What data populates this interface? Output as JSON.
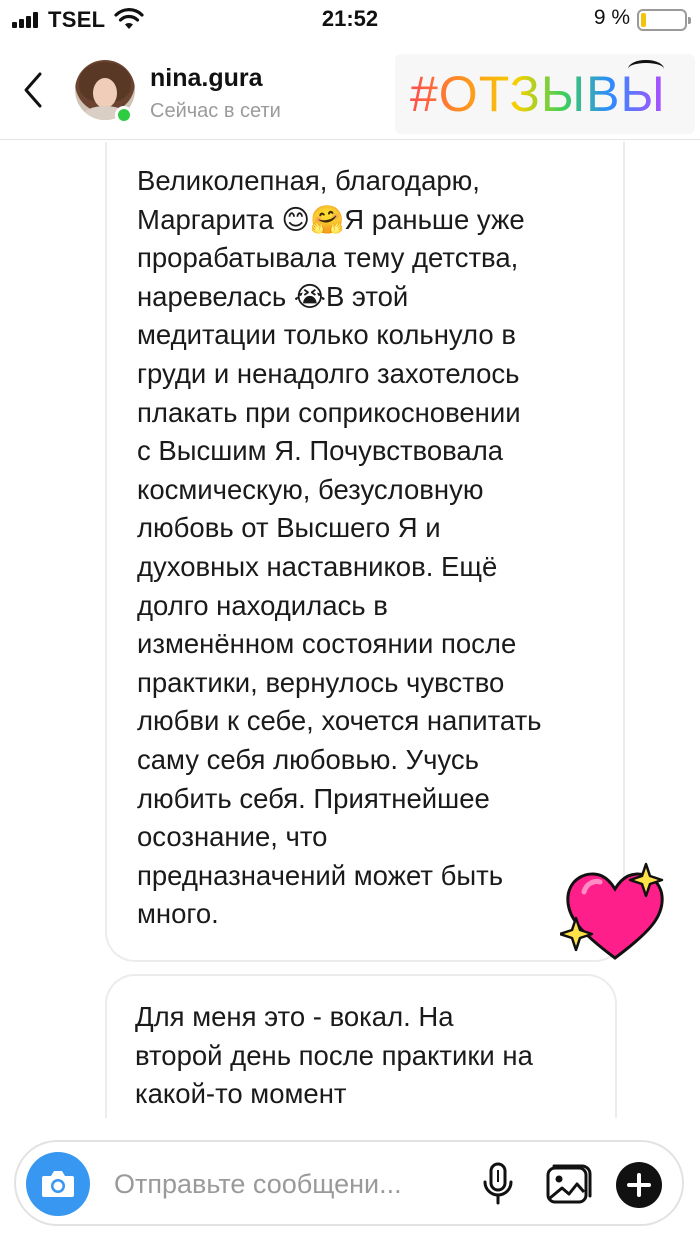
{
  "status_bar": {
    "carrier": "TSEL",
    "time": "21:52",
    "battery_percent": "9 %",
    "battery_level": 0.09
  },
  "header": {
    "username": "nina.gura",
    "presence": "Сейчас в сети",
    "sticker_text": "#ОТЗЫВЫ",
    "online": true
  },
  "messages": [
    {
      "text": "Великолепная, благодарю,\nМаргарита 😊🤗Я раньше уже\nпрорабатывала тему детства,\nнаревелась 😭В этой\nмедитации только кольнуло в\nгруди и ненадолго захотелось\nплакать при соприкосновении\nс Высшим Я. Почувствовала\nкосмическую, безусловную\nлюбовь от Высшего Я и\nдуховных наставников. Ещё\nдолго находилась в\nизменённом состоянии после\nпрактики, вернулось чувство\nлюбви к себе, хочется напитать\nсаму себя любовью. Учусь\nлюбить себя. Приятнейшее\nосознание, что\nпредназначений может быть\nмного."
    },
    {
      "text": "Для меня это - вокал. На\nвторой день после практики на\nкакой-то момент"
    }
  ],
  "composer": {
    "placeholder": "Отправьте сообщени...",
    "value": ""
  },
  "icons": {
    "back": "chevron-left-icon",
    "camera": "camera-icon",
    "mic": "microphone-icon",
    "gallery": "gallery-icon",
    "plus": "plus-icon",
    "heart": "sparkle-heart-icon"
  },
  "colors": {
    "accent": "#3897f0",
    "online": "#2ecc40",
    "heart": "#ff1f8a"
  }
}
